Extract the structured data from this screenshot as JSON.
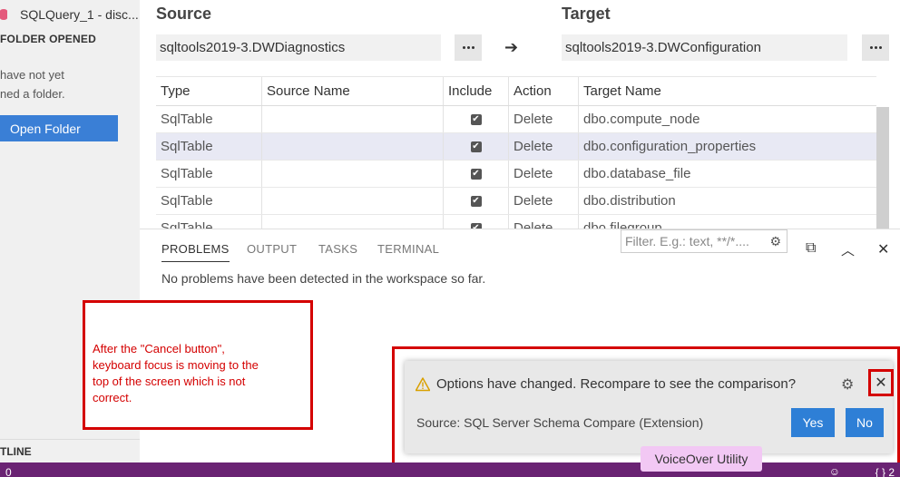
{
  "sidebar": {
    "tab_title": "SQLQuery_1 - disc...",
    "section_header": "FOLDER OPENED",
    "message_line1": "have not yet",
    "message_line2": "ned a folder.",
    "open_folder_button": "Open Folder",
    "outline_header": "TLINE"
  },
  "compare": {
    "source_label": "Source",
    "target_label": "Target",
    "source_value": "sqltools2019-3.DWDiagnostics",
    "target_value": "sqltools2019-3.DWConfiguration",
    "arrow": "➔"
  },
  "table": {
    "headers": {
      "type": "Type",
      "source_name": "Source Name",
      "include": "Include",
      "action": "Action",
      "target_name": "Target Name"
    },
    "rows": [
      {
        "type": "SqlTable",
        "source_name": "",
        "include": "✔",
        "action": "Delete",
        "target_name": "dbo.compute_node"
      },
      {
        "type": "SqlTable",
        "source_name": "",
        "include": "✔",
        "action": "Delete",
        "target_name": "dbo.configuration_properties"
      },
      {
        "type": "SqlTable",
        "source_name": "",
        "include": "✔",
        "action": "Delete",
        "target_name": "dbo.database_file"
      },
      {
        "type": "SqlTable",
        "source_name": "",
        "include": "✔",
        "action": "Delete",
        "target_name": "dbo.distribution"
      },
      {
        "type": "SqlTable",
        "source_name": "",
        "include": "✔",
        "action": "Delete",
        "target_name": "dbo.filegroup"
      }
    ]
  },
  "panel": {
    "tabs": [
      "PROBLEMS",
      "OUTPUT",
      "TASKS",
      "TERMINAL"
    ],
    "filter_placeholder": "Filter. E.g.: text, **/*....",
    "message": "No problems have been detected in the workspace so far."
  },
  "annotation": {
    "text": "After the \"Cancel button\", keyboard focus is moving to the top of the screen which is not correct."
  },
  "notification": {
    "message": "Options have changed. Recompare to see the comparison?",
    "source": "Source: SQL Server Schema Compare (Extension)",
    "yes_label": "Yes",
    "no_label": "No"
  },
  "status_bar": {
    "left": "0",
    "right": "{ } 2",
    "voiceover": "VoiceOver Utility"
  },
  "colors": {
    "primary_button": "#2e7fd6",
    "status_bar": "#6a2373",
    "annotation_red": "#d40000"
  }
}
